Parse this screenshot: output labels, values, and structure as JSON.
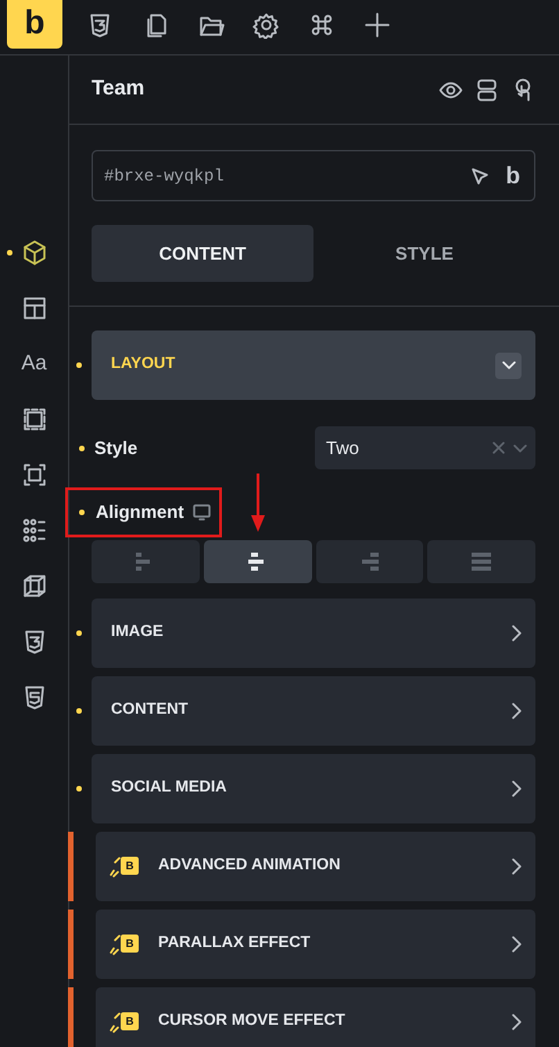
{
  "toolbar": {
    "logo": "b"
  },
  "sidebar": {
    "items": [
      {
        "selected": true
      },
      {
        "selected": false
      },
      {
        "selected": false,
        "glyph": "Aa"
      },
      {
        "selected": false
      },
      {
        "selected": false
      },
      {
        "selected": false
      },
      {
        "selected": false
      },
      {
        "selected": false
      },
      {
        "selected": false
      }
    ]
  },
  "panel": {
    "title": "Team",
    "selector": {
      "value": "#brxe-wyqkpl",
      "badge": "b"
    },
    "tabs": [
      {
        "label": "CONTENT",
        "selected": true
      },
      {
        "label": "STYLE",
        "selected": false
      }
    ],
    "sections": [
      {
        "kind": "group",
        "label": "LAYOUT",
        "expanded": true,
        "modified": true,
        "fields": [
          {
            "kind": "select",
            "label": "Style",
            "modified": true,
            "value": "Two"
          },
          {
            "kind": "align",
            "label": "Alignment",
            "modified": true,
            "highlighted": true,
            "options": [
              {
                "selected": false
              },
              {
                "selected": true
              },
              {
                "selected": false
              },
              {
                "selected": false
              }
            ]
          }
        ]
      },
      {
        "kind": "group",
        "label": "IMAGE",
        "expanded": false,
        "modified": true
      },
      {
        "kind": "group",
        "label": "CONTENT",
        "expanded": false,
        "modified": true
      },
      {
        "kind": "group",
        "label": "SOCIAL MEDIA",
        "expanded": false,
        "modified": true
      },
      {
        "kind": "plugin",
        "label": "ADVANCED ANIMATION",
        "badge": "B",
        "expanded": false
      },
      {
        "kind": "plugin",
        "label": "PARALLAX EFFECT",
        "badge": "B",
        "expanded": false
      },
      {
        "kind": "plugin",
        "label": "CURSOR MOVE EFFECT",
        "badge": "B",
        "expanded": false
      }
    ]
  }
}
